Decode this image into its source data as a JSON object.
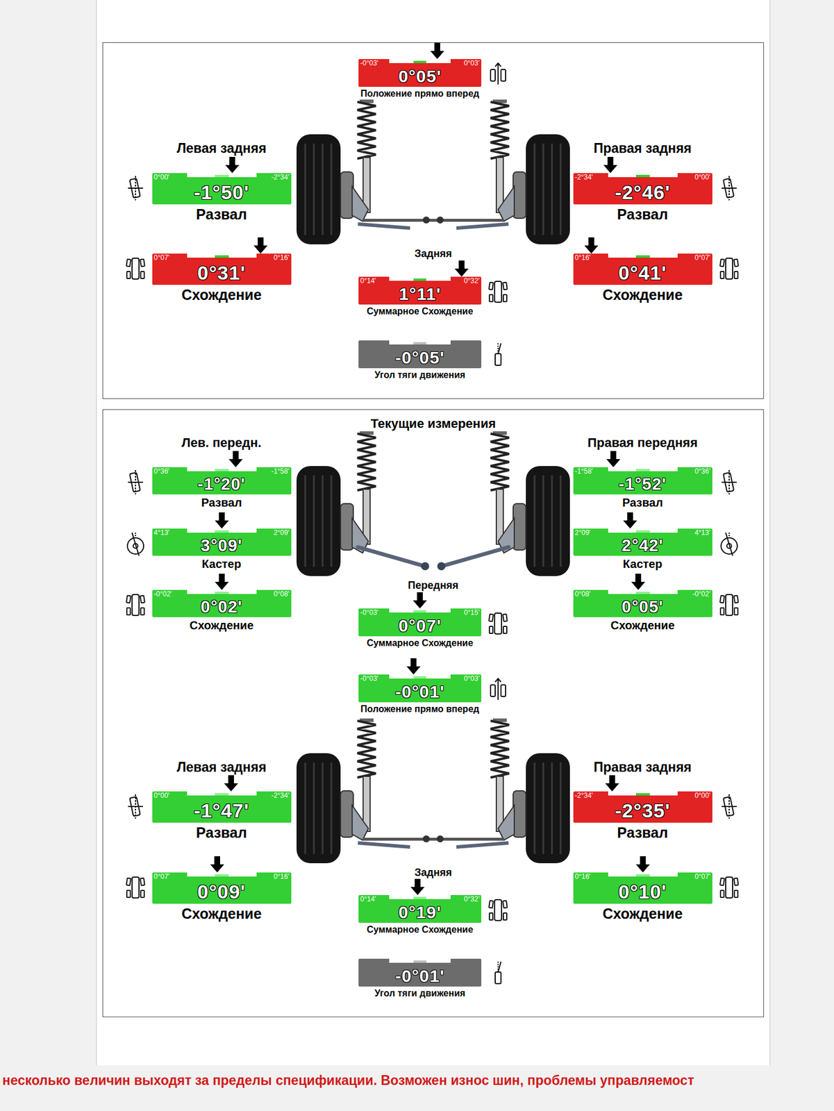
{
  "previous": {
    "straight_ahead": {
      "label": "Положение прямо вперед",
      "value": "0°05'",
      "left_mark": "-0°03'",
      "right_mark": "0°03'",
      "status": "out",
      "level": 0.64,
      "kind": "straight"
    },
    "rear": {
      "kind": "rear",
      "axle_label": "Задняя",
      "left": {
        "title": "Левая задняя",
        "gauges": [
          {
            "label": "Развал",
            "value": "-1°50'",
            "left_mark": "0°00'",
            "right_mark": "-2°34'",
            "status": "ok",
            "level": 0.575,
            "kind": "camber"
          },
          {
            "label": "Схождение",
            "value": "0°31'",
            "left_mark": "0°07'",
            "right_mark": "0°16'",
            "status": "out",
            "level": 0.78,
            "kind": "toe"
          }
        ]
      },
      "right": {
        "title": "Правая задняя",
        "gauges": [
          {
            "label": "Развал",
            "value": "-2°46'",
            "left_mark": "-2°34'",
            "right_mark": "0°00'",
            "status": "out",
            "level": 0.27,
            "kind": "camber"
          },
          {
            "label": "Схождение",
            "value": "0°41'",
            "left_mark": "0°16'",
            "right_mark": "0°07'",
            "status": "out",
            "level": 0.13,
            "kind": "toe"
          }
        ]
      },
      "total_toe": {
        "label": "Суммарное Схождение",
        "value": "1°11'",
        "left_mark": "0°14'",
        "right_mark": "0°32'",
        "status": "out",
        "level": 0.84,
        "kind": "toe"
      },
      "thrust": {
        "label": "Угол тяги движения",
        "value": "-0°05'",
        "status": "info",
        "kind": "thrust"
      }
    }
  },
  "current": {
    "title": "Текущие измерения",
    "front": {
      "kind": "front",
      "axle_label": "Передняя",
      "left": {
        "title": "Лев. передн.",
        "gauges": [
          {
            "label": "Развал",
            "value": "-1°20'",
            "left_mark": "0°36'",
            "right_mark": "-1°58'",
            "status": "ok",
            "level": 0.6,
            "kind": "camber"
          },
          {
            "label": "Кастер",
            "value": "3°09'",
            "left_mark": "4°13'",
            "right_mark": "2°09'",
            "status": "ok",
            "level": 0.5,
            "kind": "caster"
          },
          {
            "label": "Схождение",
            "value": "0°02'",
            "left_mark": "-0°02'",
            "right_mark": "0°08'",
            "status": "ok",
            "level": 0.5,
            "kind": "toe"
          }
        ]
      },
      "right": {
        "title": "Правая передняя",
        "gauges": [
          {
            "label": "Развал",
            "value": "-1°52'",
            "left_mark": "-1°58'",
            "right_mark": "0°36'",
            "status": "ok",
            "level": 0.29,
            "kind": "camber"
          },
          {
            "label": "Кастер",
            "value": "2°42'",
            "left_mark": "2°09'",
            "right_mark": "4°13'",
            "status": "ok",
            "level": 0.41,
            "kind": "caster"
          },
          {
            "label": "Схождение",
            "value": "0°05'",
            "left_mark": "0°08'",
            "right_mark": "-0°02'",
            "status": "ok",
            "level": 0.47,
            "kind": "toe"
          }
        ]
      },
      "total_toe": {
        "label": "Суммарное Схождение",
        "value": "0°07'",
        "left_mark": "-0°03'",
        "right_mark": "0°15'",
        "status": "ok",
        "level": 0.5,
        "kind": "toe"
      }
    },
    "straight_ahead": {
      "label": "Положение прямо вперед",
      "value": "-0°01'",
      "left_mark": "-0°03'",
      "right_mark": "0°03'",
      "status": "ok",
      "level": 0.45,
      "kind": "straight"
    },
    "rear": {
      "kind": "rear",
      "axle_label": "Задняя",
      "left": {
        "title": "Левая задняя",
        "gauges": [
          {
            "label": "Развал",
            "value": "-1°47'",
            "left_mark": "0°00'",
            "right_mark": "-2°34'",
            "status": "ok",
            "level": 0.57,
            "kind": "camber"
          },
          {
            "label": "Схождение",
            "value": "0°09'",
            "left_mark": "0°07'",
            "right_mark": "0°16'",
            "status": "ok",
            "level": 0.47,
            "kind": "toe"
          }
        ]
      },
      "right": {
        "title": "Правая задняя",
        "gauges": [
          {
            "label": "Развал",
            "value": "-2°35'",
            "left_mark": "-2°34'",
            "right_mark": "0°00'",
            "status": "out",
            "level": 0.28,
            "kind": "camber"
          },
          {
            "label": "Схождение",
            "value": "0°10'",
            "left_mark": "0°16'",
            "right_mark": "0°07'",
            "status": "ok",
            "level": 0.5,
            "kind": "toe"
          }
        ]
      },
      "total_toe": {
        "label": "Суммарное Схождение",
        "value": "0°19'",
        "left_mark": "0°14'",
        "right_mark": "0°32'",
        "status": "ok",
        "level": 0.48,
        "kind": "toe"
      },
      "thrust": {
        "label": "Угол тяги движения",
        "value": "-0°01'",
        "status": "info",
        "kind": "thrust"
      }
    }
  },
  "status_bar": {
    "message": "несколько величин выходят за пределы спецификации. Возможен износ шин, проблемы управляемост"
  }
}
